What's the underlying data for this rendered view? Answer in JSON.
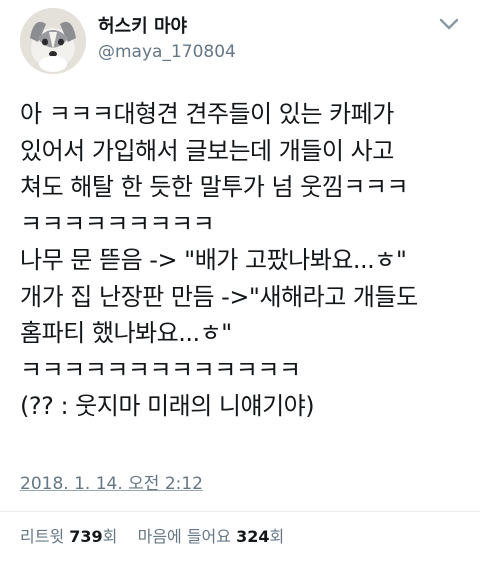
{
  "user": {
    "display_name": "허스키 마야",
    "handle": "@maya_170804",
    "avatar_icon": "husky-puppy-avatar"
  },
  "tweet": {
    "lines": [
      "아 ㅋㅋㅋ대형견 견주들이 있는 카페가",
      "있어서 가입해서 글보는데 개들이 사고",
      "쳐도 해탈 한 듯한 말투가 넘 웃낌ㅋㅋㅋ",
      "ㅋㅋㅋㅋㅋㅋㅋㅋㅋ",
      "나무 문 뜯음 -> \"배가 고팠나봐요...ㅎ\"",
      "개가 집 난장판 만듬 ->\"새해라고 개들도",
      "홈파티 했나봐요...ㅎ\"",
      "ㅋㅋㅋㅋㅋㅋㅋㅋㅋㅋㅋㅋㅋ",
      "(?? : 웃지마 미래의 니얘기야)"
    ],
    "timestamp": "2018. 1. 14. 오전 2:12"
  },
  "stats": {
    "retweets_label": "리트윗",
    "retweets_count": "739",
    "retweets_unit": "회",
    "likes_label": "마음에 들어요",
    "likes_count": "324",
    "likes_unit": "회"
  },
  "icons": {
    "menu": "chevron-down-icon"
  },
  "colors": {
    "text": "#14171a",
    "secondary": "#657786",
    "divider": "#e6ecf0"
  }
}
